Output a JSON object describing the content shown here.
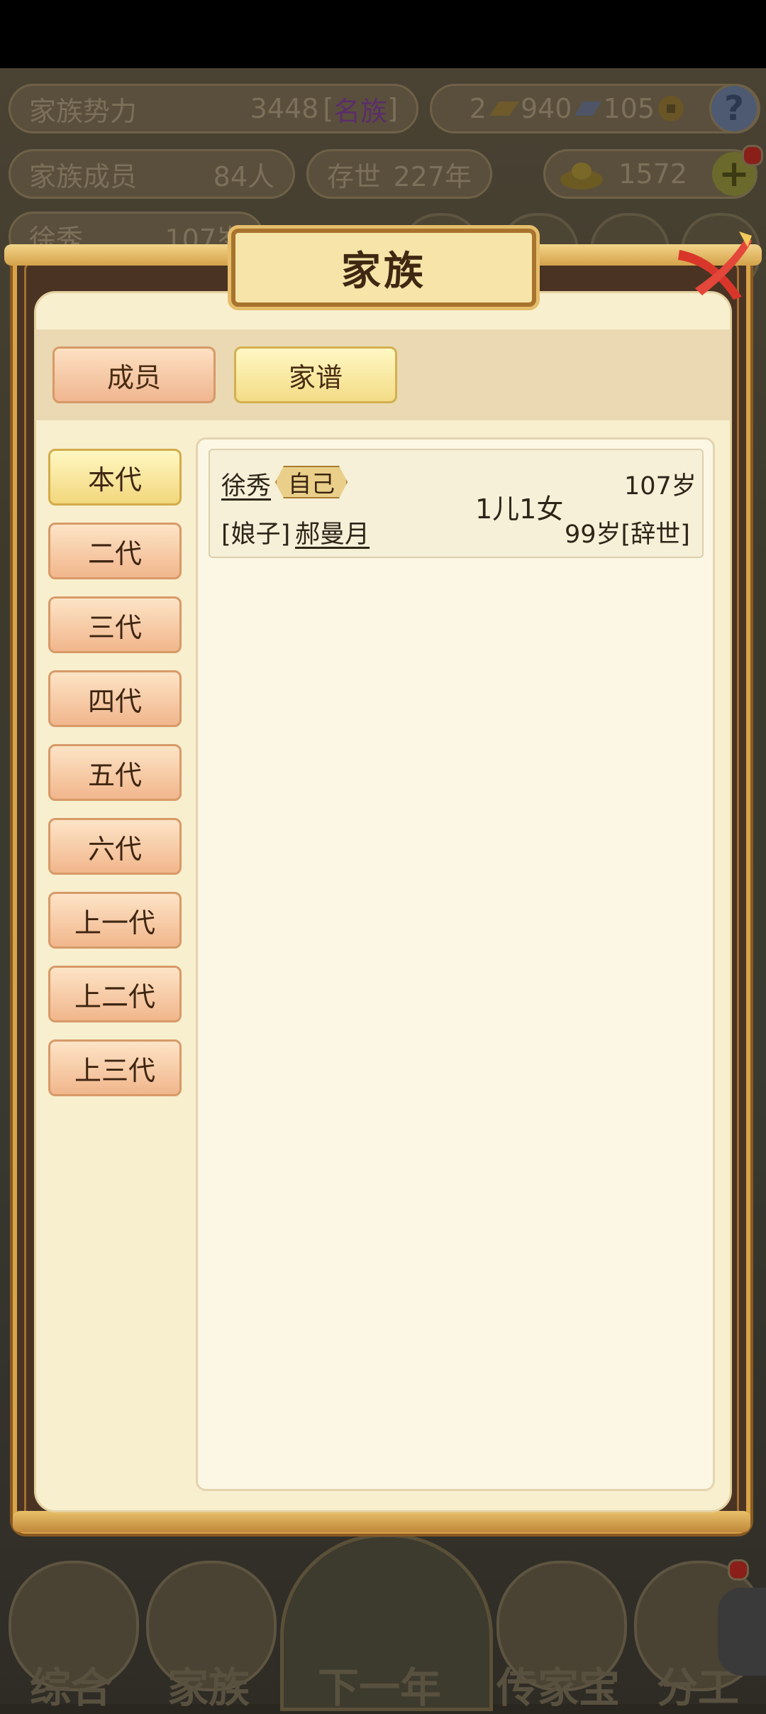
{
  "background": {
    "power": {
      "label": "家族势力",
      "value": "3448",
      "rank_bracket_open": "[",
      "rank": "名族",
      "rank_bracket_close": "]"
    },
    "resources": {
      "amount1": "2",
      "amount2": "940",
      "amount3": "105"
    },
    "members": {
      "label": "家族成员",
      "value": "84人"
    },
    "existence": {
      "label": "存世",
      "value": "227年"
    },
    "gold": {
      "value": "1572"
    },
    "person": {
      "name": "徐秀",
      "age": "107岁"
    },
    "help_glyph": "?",
    "plus_glyph": "+",
    "nav": [
      "综合",
      "家族",
      "下一年",
      "传家宝",
      "分工"
    ]
  },
  "modal": {
    "title": "家族",
    "close_glyph": "✕",
    "tabs": [
      {
        "label": "成员",
        "active": false
      },
      {
        "label": "家谱",
        "active": true
      }
    ],
    "generations": [
      "本代",
      "二代",
      "三代",
      "四代",
      "五代",
      "六代",
      "上一代",
      "上二代",
      "上三代"
    ],
    "active_generation": "本代",
    "entries": [
      {
        "name": "徐秀",
        "tag": "自己",
        "age": "107岁",
        "spouse_role": "[娘子]",
        "spouse_name": "郝曼月",
        "children": "1儿1女",
        "spouse_status": "99岁[辞世]"
      }
    ]
  },
  "colors": {
    "accent_gold": "#d8a349",
    "panel_bg": "#f8efcf",
    "button_peach": "#f1b68c",
    "button_active": "#f2d77c"
  }
}
